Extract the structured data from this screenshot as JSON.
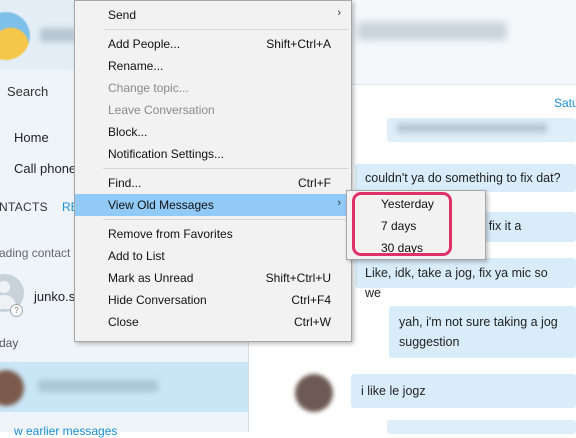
{
  "sidebar": {
    "search_label": "Search",
    "nav": [
      {
        "label": "Home"
      },
      {
        "label": "Call phone"
      }
    ],
    "tabs": {
      "contacts": "NTACTS",
      "recent": "RE"
    },
    "loading_text": "ading contact",
    "contact_name": "junko.s",
    "today_label": "day",
    "earlier_link": "w earlier messages"
  },
  "chat": {
    "date_label": "Satu",
    "messages": [
      {
        "text": "couldn't ya do something to fix dat?"
      },
      {
        "text": "Like, idk, take a jog, fix ya mic so we"
      },
      {
        "text": "yah, i'm not sure taking a jog"
      },
      {
        "text": "suggestion"
      },
      {
        "text": "i like le jogz"
      },
      {
        "text": "o do to fix it a"
      }
    ]
  },
  "context_menu": {
    "items": [
      {
        "label": "Send",
        "shortcut": "",
        "submenu": true
      },
      {
        "label": "Add People...",
        "shortcut": "Shift+Ctrl+A"
      },
      {
        "label": "Rename...",
        "shortcut": ""
      },
      {
        "label": "Change topic...",
        "shortcut": "",
        "disabled": true
      },
      {
        "label": "Leave Conversation",
        "shortcut": "",
        "disabled": true
      },
      {
        "label": "Block...",
        "shortcut": ""
      },
      {
        "label": "Notification Settings...",
        "shortcut": ""
      },
      {
        "label": "Find...",
        "shortcut": "Ctrl+F"
      },
      {
        "label": "View Old Messages",
        "shortcut": "",
        "submenu": true,
        "highlighted": true
      },
      {
        "label": "Remove from Favorites",
        "shortcut": ""
      },
      {
        "label": "Add to List",
        "shortcut": ""
      },
      {
        "label": "Mark as Unread",
        "shortcut": "Shift+Ctrl+U"
      },
      {
        "label": "Hide Conversation",
        "shortcut": "Ctrl+F4"
      },
      {
        "label": "Close",
        "shortcut": "Ctrl+W"
      }
    ]
  },
  "submenu": {
    "items": [
      {
        "label": "Yesterday"
      },
      {
        "label": "7 days"
      },
      {
        "label": "30 days"
      }
    ]
  },
  "colors": {
    "menu_highlight": "#91c9f7",
    "annotation": "#e0306a",
    "link": "#1d8fd4"
  }
}
